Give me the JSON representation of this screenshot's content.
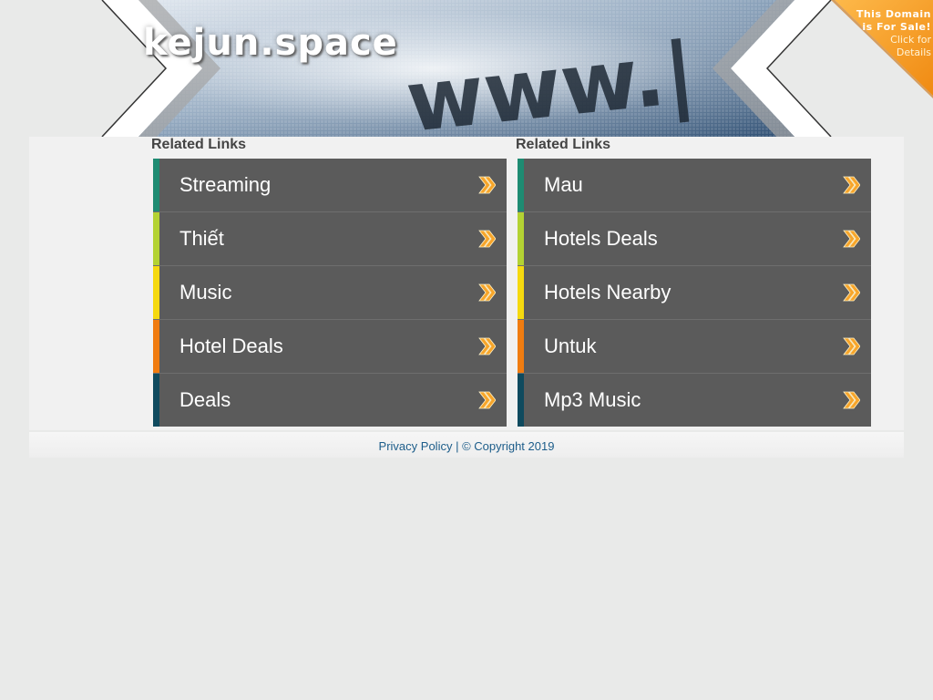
{
  "header": {
    "site_title": "kejun.space",
    "sale_ribbon": {
      "line1": "This Domain",
      "line2": "is For Sale!",
      "line3": "Click for",
      "line4": "Details",
      "color": "#f7941d"
    },
    "banner_image_text": "www.|"
  },
  "related_links_left": {
    "heading": "Related Links",
    "items": [
      {
        "label": "Streaming",
        "color": "#1e8b72"
      },
      {
        "label": "Thiết",
        "color": "#b3d233"
      },
      {
        "label": "Music",
        "color": "#f5d90f"
      },
      {
        "label": "Hotel Deals",
        "color": "#f07c10"
      },
      {
        "label": "Deals",
        "color": "#0f4a5e"
      }
    ]
  },
  "related_links_right": {
    "heading": "Related Links",
    "items": [
      {
        "label": "Mau",
        "color": "#1e8b72"
      },
      {
        "label": "Hotels Deals",
        "color": "#b3d233"
      },
      {
        "label": "Hotels Nearby",
        "color": "#f5d90f"
      },
      {
        "label": "Untuk",
        "color": "#f07c10"
      },
      {
        "label": "Mp3 Music",
        "color": "#0f4a5e"
      }
    ]
  },
  "footer": {
    "privacy_label": "Privacy Policy",
    "separator": " | ",
    "copyright": "© Copyright 2019"
  }
}
